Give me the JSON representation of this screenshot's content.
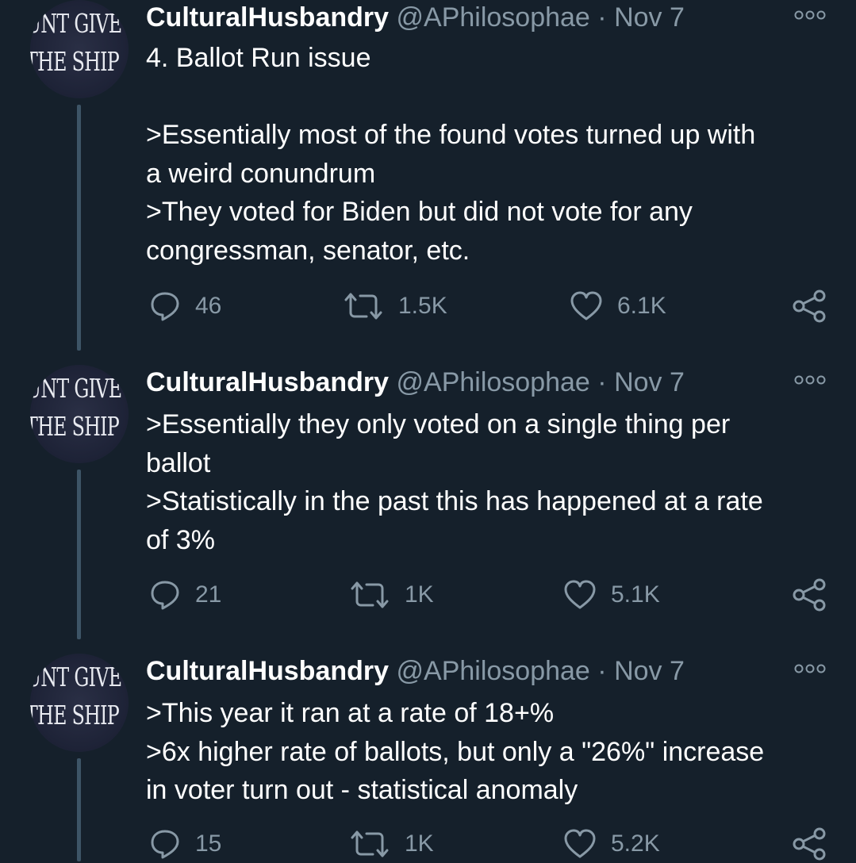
{
  "tweets": [
    {
      "avatar": {
        "line1": "UNT GIVE",
        "line2": "THE SHIP"
      },
      "name": "CulturalHusbandry",
      "handle": "@APhilosophae",
      "dot": "·",
      "date": "Nov 7",
      "lines": [
        "4. Ballot Run issue",
        "",
        ">Essentially most of the found votes turned up with",
        "a weird conundrum",
        ">They voted for Biden but did not vote for any",
        "congressman, senator, etc."
      ],
      "replies": "46",
      "retweets": "1.5K",
      "likes": "6.1K"
    },
    {
      "avatar": {
        "line1": "UNT GIVE",
        "line2": "THE SHIP"
      },
      "name": "CulturalHusbandry",
      "handle": "@APhilosophae",
      "dot": "·",
      "date": "Nov 7",
      "lines": [
        ">Essentially they only voted on a single thing per",
        "ballot",
        ">Statistically in the past this has happened at a rate",
        "of 3%"
      ],
      "replies": "21",
      "retweets": "1K",
      "likes": "5.1K"
    },
    {
      "avatar": {
        "line1": "UNT GIVE",
        "line2": "THE SHIP"
      },
      "name": "CulturalHusbandry",
      "handle": "@APhilosophae",
      "dot": "·",
      "date": "Nov 7",
      "lines": [
        ">This year it ran at a rate of 18+%",
        ">6x higher rate of ballots, but only a \"26%\" increase",
        "in voter turn out - statistical anomaly"
      ],
      "replies": "15",
      "retweets": "1K",
      "likes": "5.2K"
    }
  ],
  "icons": {
    "reply": "reply-icon",
    "retweet": "retweet-icon",
    "like": "heart-icon",
    "share": "share-icon",
    "more": "more-options-icon"
  },
  "colors": {
    "background": "#15202b",
    "secondary_text": "#8899a6",
    "thread_line": "#3d5466"
  }
}
